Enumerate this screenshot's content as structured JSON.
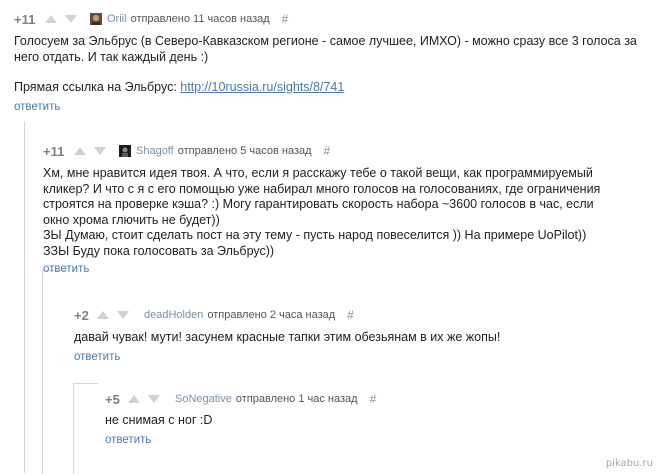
{
  "comments": [
    {
      "rating": "+11",
      "author": "Oriil",
      "sent": "отправлено 11 часов назад",
      "hash": "#",
      "lines": [
        "Голосуем за Эльбрус (в Северо-Кавказском регионе - самое лучшее, ИМХО) - можно сразу все 3 голоса за",
        "него отдать. И так каждый день :)"
      ],
      "link_prefix": "Прямая ссылка на Эльбрус: ",
      "link_text": "http://10russia.ru/sights/8/741",
      "reply": "ответить"
    },
    {
      "rating": "+11",
      "author": "Shagoff",
      "sent": "отправлено 5 часов назад",
      "hash": "#",
      "lines": [
        "Хм, мне нравится идея твоя. А что, если я расскажу тебе о такой вещи, как программируемый",
        "кликер? И что с я с его помощью уже набирал много голосов на голосованиях, где ограничения",
        "строятся на проверке кэша? :) Могу гарантировать скорость набора ~3600 голосов в час, если",
        "окно хрома глючить не будет))",
        "ЗЫ Думаю, стоит сделать пост на эту тему - пусть народ повеселится )) На примере UoPilot))",
        "ЗЗЫ Буду пока голосовать за Эльбрус))"
      ],
      "reply": "ответить"
    },
    {
      "rating": "+2",
      "author": "deadHolden",
      "sent": "отправлено 2 часа назад",
      "hash": "#",
      "lines": [
        "давай чувак! мути! засунем красные тапки этим обезьянам в их же жопы!"
      ],
      "reply": "ответить"
    },
    {
      "rating": "+5",
      "author": "SoNegative",
      "sent": "отправлено 1 час назад",
      "hash": "#",
      "lines": [
        "не снимая с ног :D"
      ],
      "reply": "ответить"
    }
  ],
  "watermark": "pikabu.ru"
}
